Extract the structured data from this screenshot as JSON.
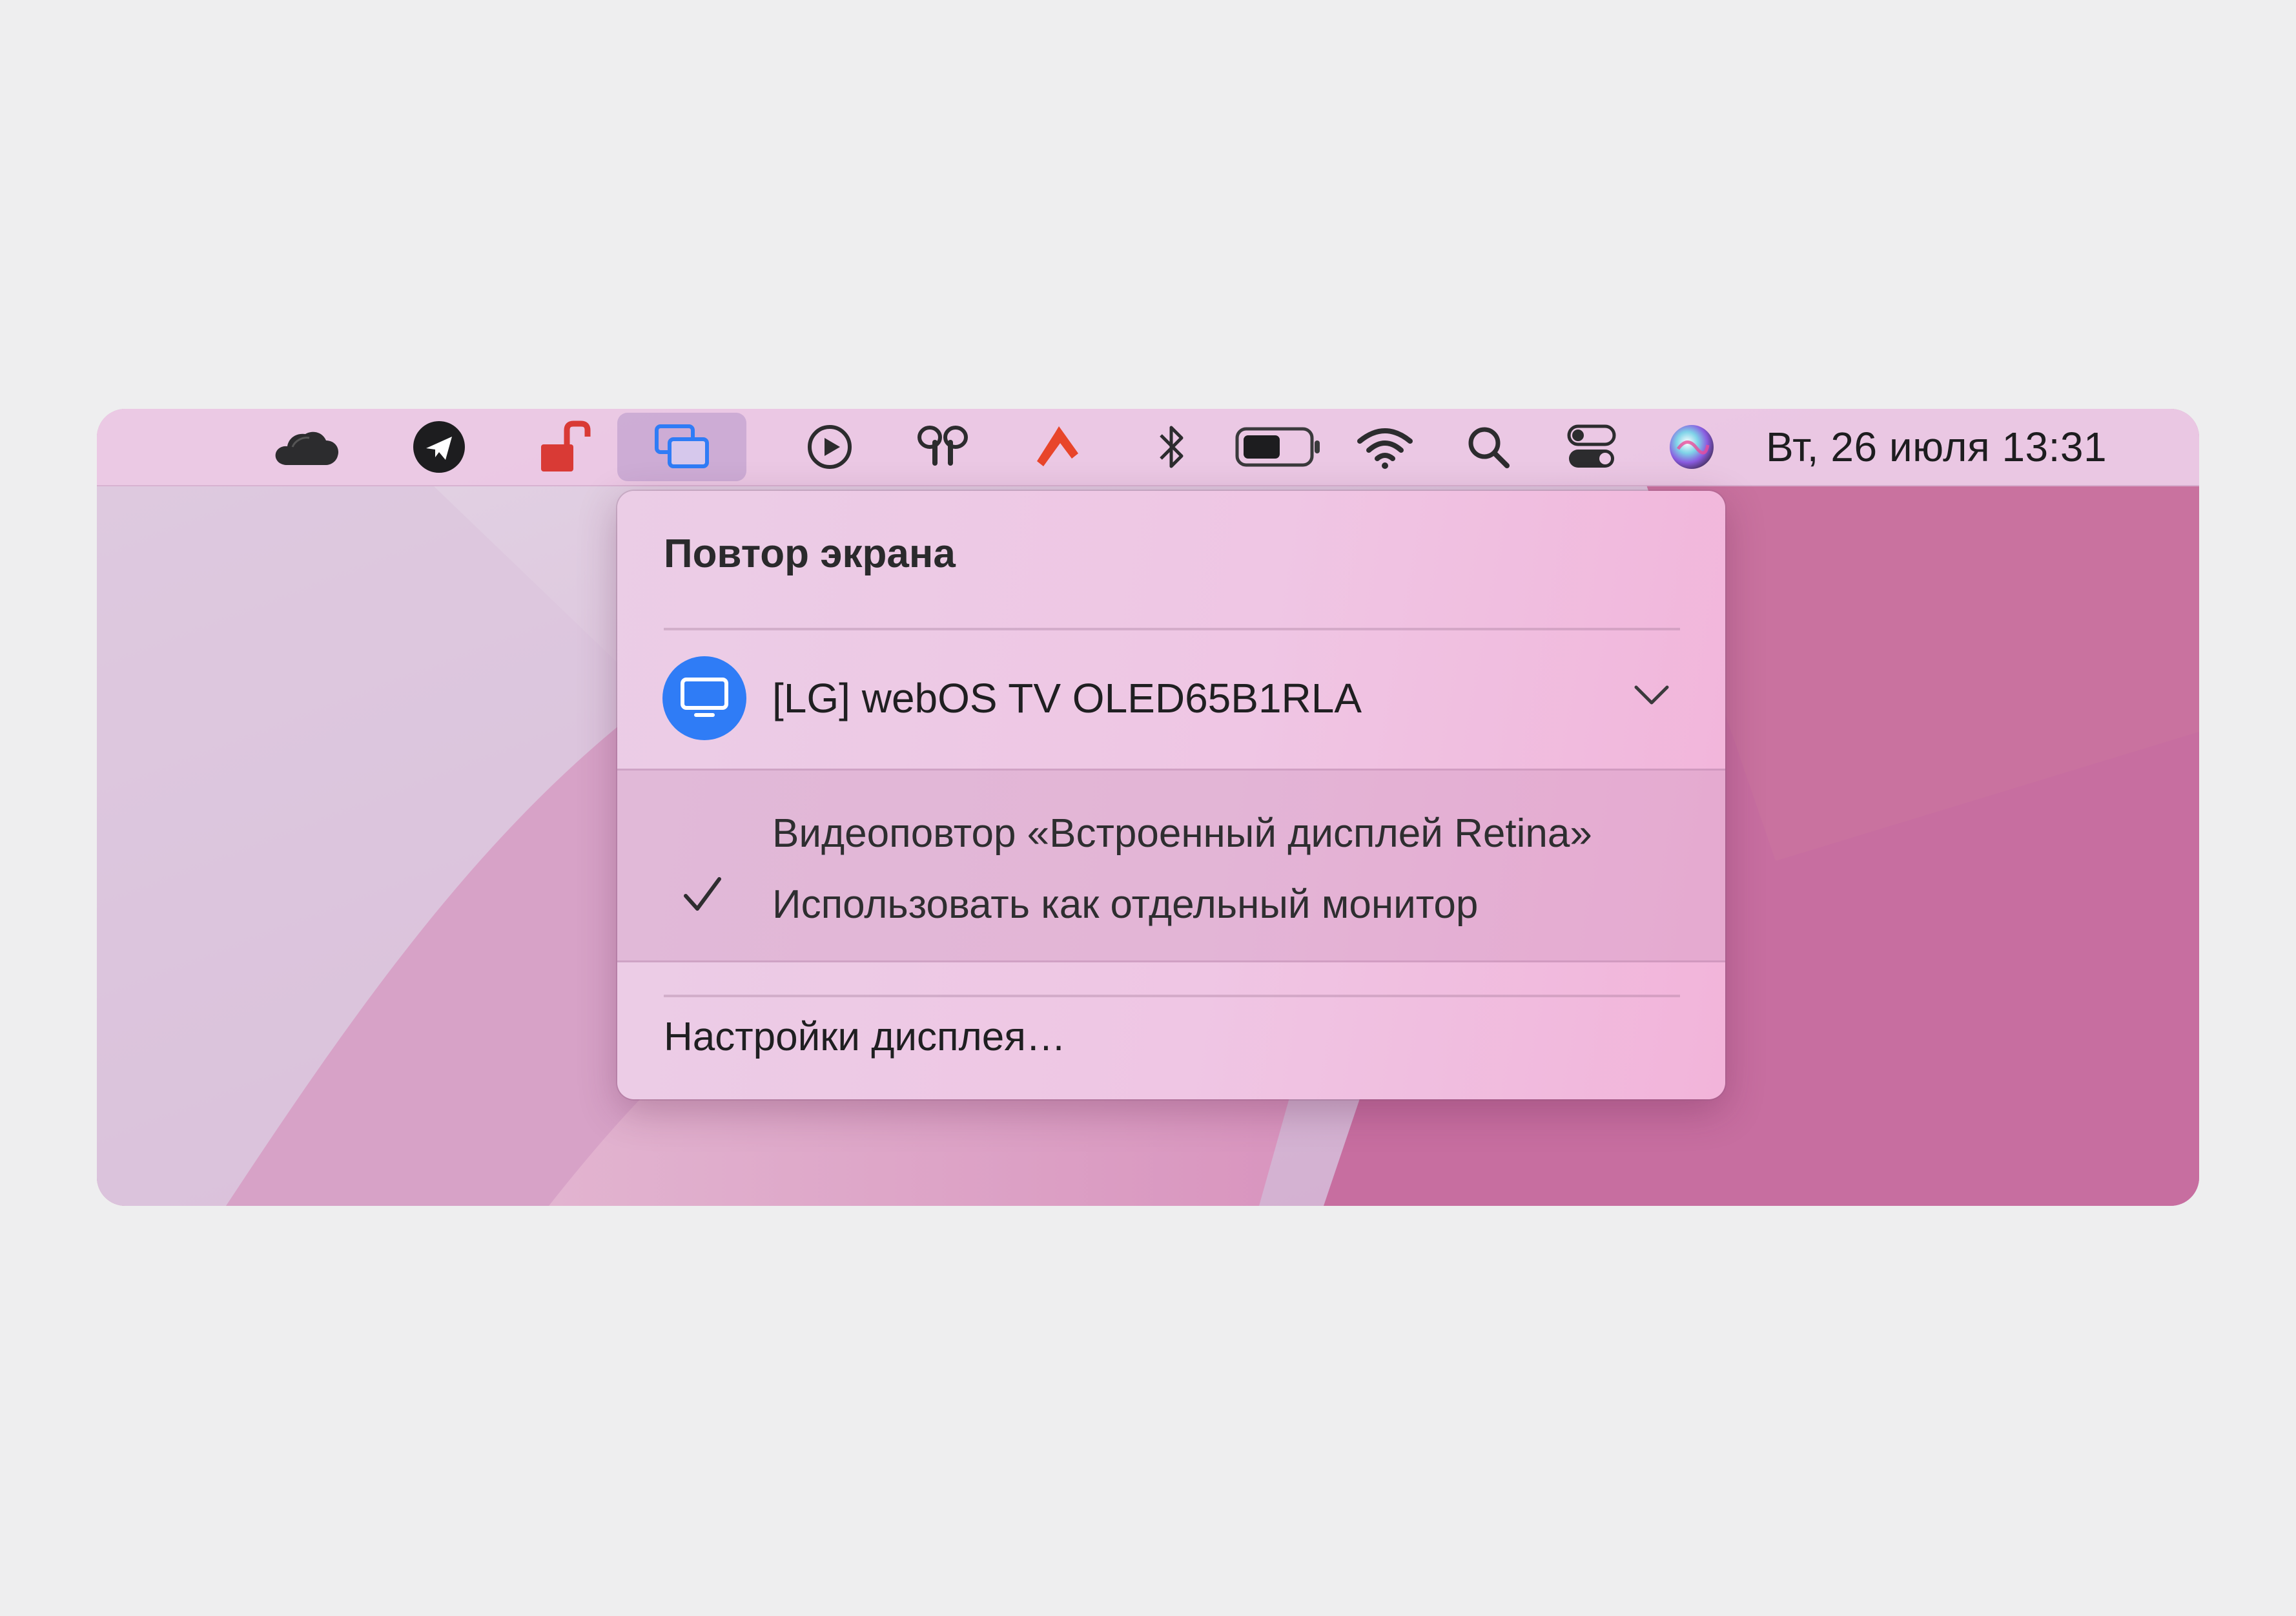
{
  "menubar": {
    "clock": "Вт, 26 июля  13:31",
    "icons": [
      "cloud-icon",
      "telegram-icon",
      "unlock-icon",
      "screen-mirroring-icon",
      "play-icon",
      "airpods-icon",
      "hammer-icon",
      "bluetooth-icon",
      "battery-icon",
      "wifi-icon",
      "search-icon",
      "control-center-icon",
      "siri-icon"
    ],
    "active_icon": "screen-mirroring-icon"
  },
  "dropdown": {
    "title": "Повтор экрана",
    "device": {
      "name": "[LG] webOS TV OLED65B1RLA",
      "icon": "display-icon",
      "expand_icon": "chevron-down-icon"
    },
    "options": [
      {
        "label": "Видеоповтор «Встроенный дисплей Retina»",
        "checked": false
      },
      {
        "label": "Использовать как отдельный монитор",
        "checked": true
      }
    ],
    "settings_label": "Настройки дисплея…"
  },
  "colors": {
    "accent": "#2f7cf6",
    "hammer": "#e8452a",
    "unlock": "#d93a35",
    "wallpaper": "#c76ea0"
  }
}
